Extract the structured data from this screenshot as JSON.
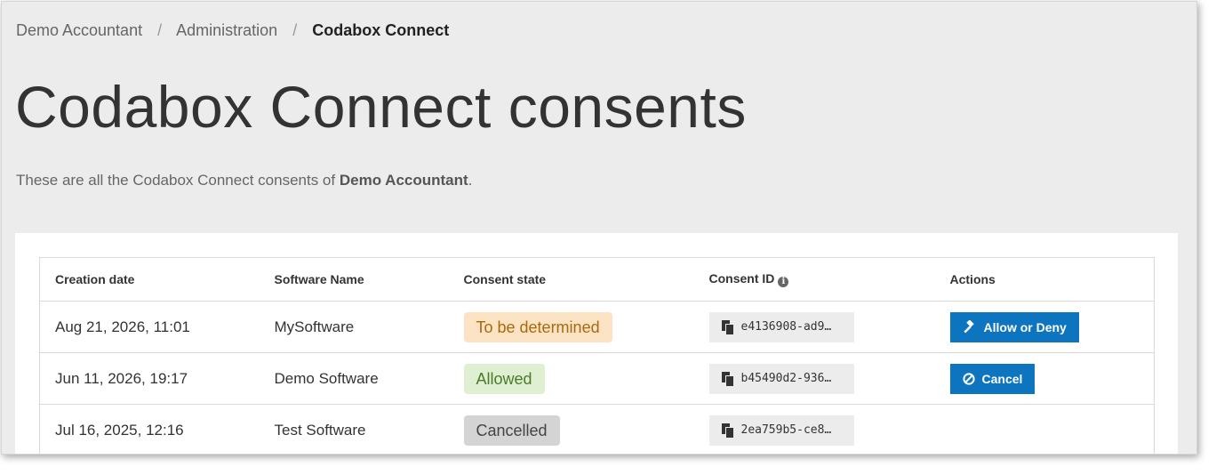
{
  "breadcrumb": {
    "items": [
      "Demo Accountant",
      "Administration"
    ],
    "separator": "/",
    "current": "Codabox Connect"
  },
  "page": {
    "title": "Codabox Connect consents",
    "intro_prefix": "These are all the Codabox Connect consents of ",
    "intro_org": "Demo Accountant",
    "intro_suffix": "."
  },
  "table": {
    "headers": {
      "creation_date": "Creation date",
      "software_name": "Software Name",
      "consent_state": "Consent state",
      "consent_id": "Consent ID",
      "actions": "Actions"
    },
    "rows": [
      {
        "creation_date": "Aug 21, 2026, 11:01",
        "software_name": "MySoftware",
        "state": "To be determined",
        "state_color": "#fbe3c3",
        "consent_id": "e4136908-ad9…",
        "action": "Allow or Deny",
        "action_icon": "gavel-icon"
      },
      {
        "creation_date": "Jun 11, 2026, 19:17",
        "software_name": "Demo Software",
        "state": "Allowed",
        "state_color": "#dff0d2",
        "consent_id": "b45490d2-936…",
        "action": "Cancel",
        "action_icon": "ban-icon"
      },
      {
        "creation_date": "Jul 16, 2025, 12:16",
        "software_name": "Test Software",
        "state": "Cancelled",
        "state_color": "#d4d4d4",
        "consent_id": "2ea759b5-ce8…"
      }
    ]
  },
  "colors": {
    "accent": "#0d74c0",
    "background": "#ececec"
  }
}
